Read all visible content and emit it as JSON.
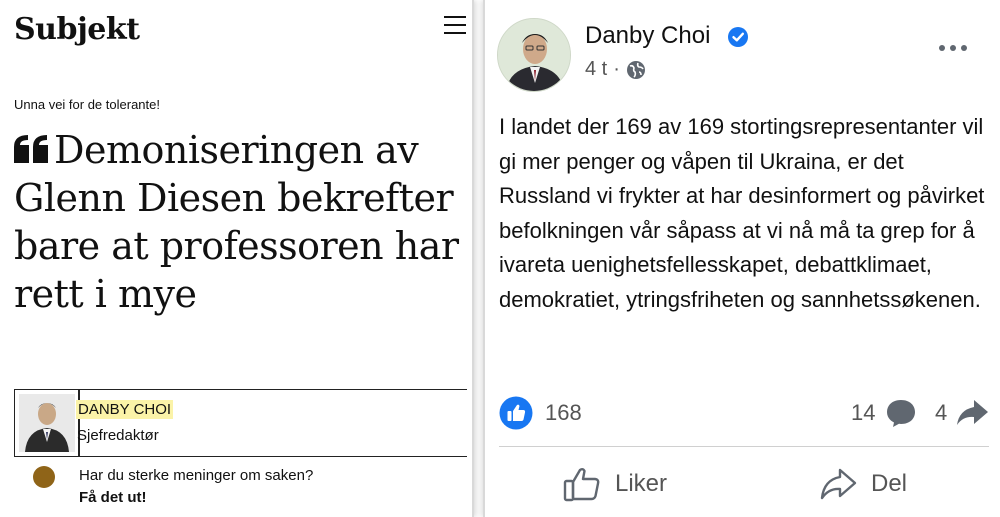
{
  "article": {
    "logo": "Subjekt",
    "kicker": "Unna vei for de tolerante!",
    "headline": "Demoniseringen av Glenn Diesen bekrefter bare at professoren har rett i mye",
    "author_name": "DANBY CHOI",
    "author_role": "Sjefredaktør",
    "cta_text": "Har du sterke meninger om saken?",
    "cta_link": "Få det ut!",
    "colors": {
      "highlight": "#fbf3a8",
      "cta_dot": "#8f6418"
    }
  },
  "post": {
    "author": "Danby Choi",
    "time": "4 t",
    "separator": "·",
    "text": "I landet der 169 av 169 stortingsrepresentanter vil gi mer penger og våpen til Ukraina, er det Russland vi frykter at har desinformert og påvirket befolkningen vår såpass at vi nå må ta grep for å ivareta uenighetsfellesskapet, debattklimaet, demokratiet, ytringsfriheten og sannhetssøkenen.",
    "reactions": "168",
    "comments": "14",
    "shares": "4",
    "like_label": "Liker",
    "share_label": "Del",
    "colors": {
      "facebook_blue": "#1877f2",
      "icon_gray": "#606770"
    }
  }
}
